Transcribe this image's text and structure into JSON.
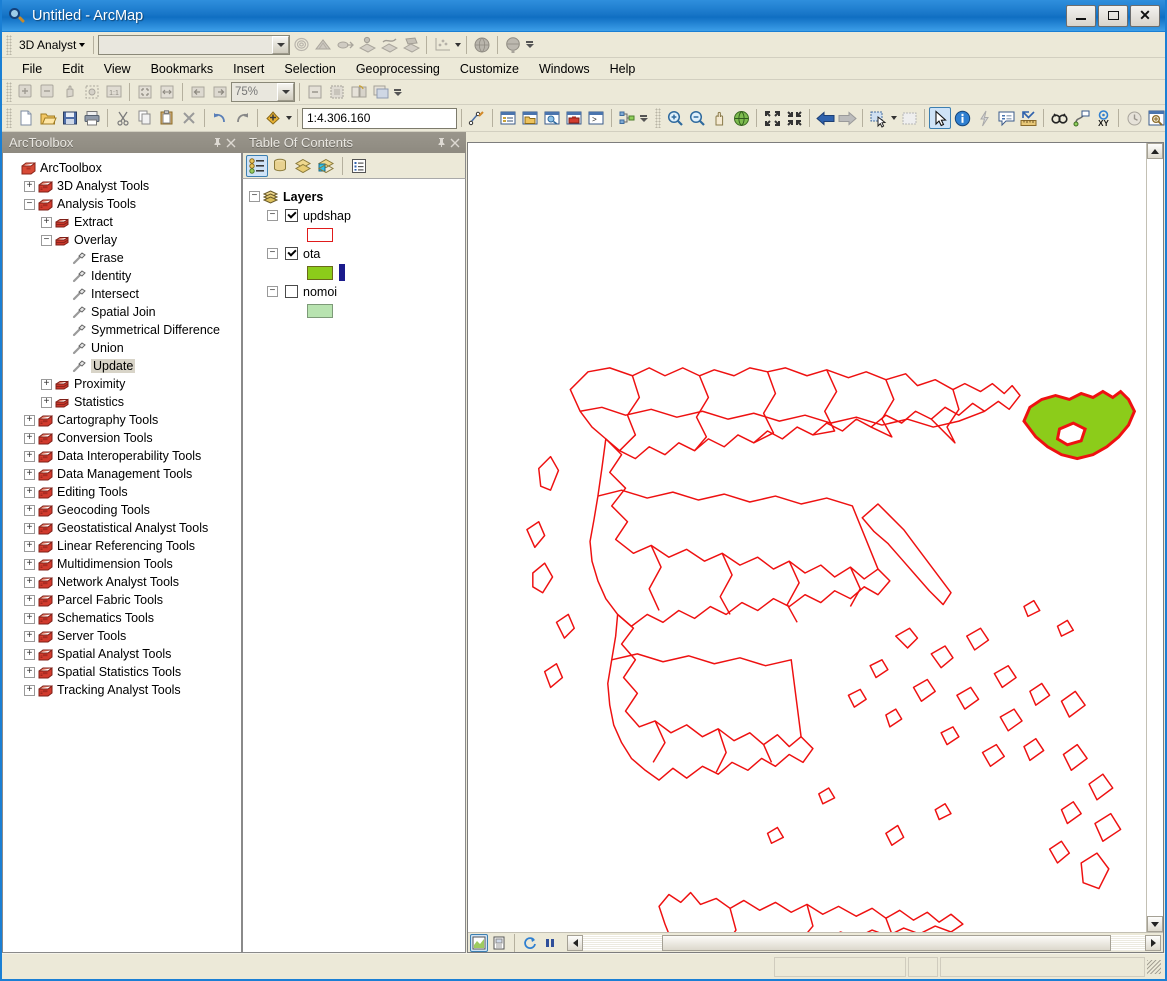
{
  "window": {
    "title": "Untitled - ArcMap",
    "icon": "arcmap-magnifier-icon",
    "minimize_label": "_",
    "maximize_label": "□",
    "close_label": "✕"
  },
  "analyst_toolbar": {
    "dropdown_label": "3D Analyst",
    "layer_combo_value": "",
    "icons": [
      "interpolate-contour-icon",
      "create-tin-icon",
      "surface-analysis-icon",
      "point-interpolation-icon",
      "line-interpolation-icon",
      "area-interpolation-icon",
      "scatter-plot-icon",
      "globe-scene-icon",
      "arcglobe-icon"
    ]
  },
  "menubar": {
    "items": [
      "File",
      "Edit",
      "View",
      "Bookmarks",
      "Insert",
      "Selection",
      "Geoprocessing",
      "Customize",
      "Windows",
      "Help"
    ]
  },
  "tools_toolbar": {
    "zoom_value": "75%",
    "icons": [
      "zoom-in-icon",
      "zoom-out-icon",
      "pan-icon",
      "full-extent-icon",
      "fixed-zoom-icon",
      "zoom-whole-page-icon",
      "zoom-page-width-icon",
      "go-back-extent-icon",
      "go-forward-extent-icon"
    ],
    "icons_right": [
      "toggle-draft-mode-icon",
      "focus-data-frame-icon",
      "change-layout-icon",
      "data-driven-pages-icon"
    ]
  },
  "standard_toolbar": {
    "scale_value": "1:4.306.160",
    "icons": [
      "new-document-icon",
      "open-icon",
      "save-icon",
      "print-icon",
      "cut-icon",
      "copy-icon",
      "paste-icon",
      "delete-icon",
      "undo-icon",
      "redo-icon",
      "add-data-icon",
      "editor-toolbar-icon",
      "table-of-contents-icon",
      "catalog-window-icon",
      "search-window-icon",
      "arctoolbox-icon",
      "python-window-icon",
      "model-builder-icon"
    ],
    "nav_icons": [
      "zoom-in-icon",
      "zoom-out-icon",
      "pan-icon",
      "full-extent-icon",
      "zoom-in-fixed-icon",
      "zoom-out-fixed-icon",
      "back-extent-icon",
      "forward-extent-icon",
      "select-features-icon",
      "clear-selection-icon",
      "select-elements-icon",
      "identify-icon",
      "hyperlink-icon",
      "html-popup-icon",
      "measure-icon",
      "find-icon",
      "find-route-icon",
      "go-to-xy-icon",
      "time-slider-icon",
      "create-viewer-window-icon"
    ]
  },
  "toolbox_panel": {
    "title": "ArcToolbox",
    "pin_icon": "pin-icon",
    "close_icon": "close-icon",
    "root": "ArcToolbox",
    "tree": [
      {
        "label": "ArcToolbox",
        "level": 0,
        "state": "none",
        "icon": "toolbox-root-icon"
      },
      {
        "label": "3D Analyst Tools",
        "level": 1,
        "state": "collapsed",
        "icon": "toolbox-icon"
      },
      {
        "label": "Analysis Tools",
        "level": 1,
        "state": "expanded",
        "icon": "toolbox-icon"
      },
      {
        "label": "Extract",
        "level": 2,
        "state": "collapsed",
        "icon": "toolset-icon"
      },
      {
        "label": "Overlay",
        "level": 2,
        "state": "expanded",
        "icon": "toolset-icon"
      },
      {
        "label": "Erase",
        "level": 3,
        "state": "none",
        "icon": "tool-icon"
      },
      {
        "label": "Identity",
        "level": 3,
        "state": "none",
        "icon": "tool-icon"
      },
      {
        "label": "Intersect",
        "level": 3,
        "state": "none",
        "icon": "tool-icon"
      },
      {
        "label": "Spatial Join",
        "level": 3,
        "state": "none",
        "icon": "tool-icon"
      },
      {
        "label": "Symmetrical Difference",
        "level": 3,
        "state": "none",
        "icon": "tool-icon"
      },
      {
        "label": "Union",
        "level": 3,
        "state": "none",
        "icon": "tool-icon"
      },
      {
        "label": "Update",
        "level": 3,
        "state": "none",
        "icon": "tool-icon",
        "highlighted": true
      },
      {
        "label": "Proximity",
        "level": 2,
        "state": "collapsed",
        "icon": "toolset-icon"
      },
      {
        "label": "Statistics",
        "level": 2,
        "state": "collapsed",
        "icon": "toolset-icon"
      },
      {
        "label": "Cartography Tools",
        "level": 1,
        "state": "collapsed",
        "icon": "toolbox-icon"
      },
      {
        "label": "Conversion Tools",
        "level": 1,
        "state": "collapsed",
        "icon": "toolbox-icon"
      },
      {
        "label": "Data Interoperability Tools",
        "level": 1,
        "state": "collapsed",
        "icon": "toolbox-icon"
      },
      {
        "label": "Data Management Tools",
        "level": 1,
        "state": "collapsed",
        "icon": "toolbox-icon"
      },
      {
        "label": "Editing Tools",
        "level": 1,
        "state": "collapsed",
        "icon": "toolbox-icon"
      },
      {
        "label": "Geocoding Tools",
        "level": 1,
        "state": "collapsed",
        "icon": "toolbox-icon"
      },
      {
        "label": "Geostatistical Analyst Tools",
        "level": 1,
        "state": "collapsed",
        "icon": "toolbox-icon"
      },
      {
        "label": "Linear Referencing Tools",
        "level": 1,
        "state": "collapsed",
        "icon": "toolbox-icon"
      },
      {
        "label": "Multidimension Tools",
        "level": 1,
        "state": "collapsed",
        "icon": "toolbox-icon"
      },
      {
        "label": "Network Analyst Tools",
        "level": 1,
        "state": "collapsed",
        "icon": "toolbox-icon"
      },
      {
        "label": "Parcel Fabric Tools",
        "level": 1,
        "state": "collapsed",
        "icon": "toolbox-icon"
      },
      {
        "label": "Schematics Tools",
        "level": 1,
        "state": "collapsed",
        "icon": "toolbox-icon"
      },
      {
        "label": "Server Tools",
        "level": 1,
        "state": "collapsed",
        "icon": "toolbox-icon"
      },
      {
        "label": "Spatial Analyst Tools",
        "level": 1,
        "state": "collapsed",
        "icon": "toolbox-icon"
      },
      {
        "label": "Spatial Statistics Tools",
        "level": 1,
        "state": "collapsed",
        "icon": "toolbox-icon"
      },
      {
        "label": "Tracking Analyst Tools",
        "level": 1,
        "state": "collapsed",
        "icon": "toolbox-icon"
      }
    ]
  },
  "toc_panel": {
    "title": "Table Of Contents",
    "pin_icon": "pin-icon",
    "close_icon": "close-icon",
    "toolbar_icons": [
      "list-by-drawing-order-icon",
      "list-by-source-icon",
      "list-by-visibility-icon",
      "list-by-selection-icon",
      "toc-options-icon"
    ],
    "root_label": "Layers",
    "root_icon": "data-frame-icon",
    "layers": [
      {
        "name": "updshap",
        "checked": true,
        "symbol": "outline",
        "fill": "#ffffff",
        "stroke": "#e01b1b"
      },
      {
        "name": "ota",
        "checked": true,
        "symbol": "fill-bar",
        "fill": "#8ccc1a",
        "stroke": "#6a6a1a",
        "bar_color": "#1b1b8c"
      },
      {
        "name": "nomoi",
        "checked": false,
        "symbol": "fill",
        "fill": "#b8e3b0",
        "stroke": "#7d9a78"
      }
    ]
  },
  "map": {
    "background": "#ffffff",
    "boundary_color": "#ee1111",
    "selected_fill": "#8ccc1a",
    "selected_outline": "#ee1111",
    "bottom_bar_icons": [
      "data-view-icon",
      "layout-view-icon",
      "refresh-icon",
      "pause-drawing-icon"
    ],
    "scroll_left_icon": "scroll-left-icon",
    "scroll_right_icon": "scroll-right-icon",
    "scroll_up_icon": "scroll-up-icon",
    "scroll_down_icon": "scroll-down-icon"
  },
  "statusbar": {
    "message": "",
    "coords": "",
    "units": ""
  }
}
